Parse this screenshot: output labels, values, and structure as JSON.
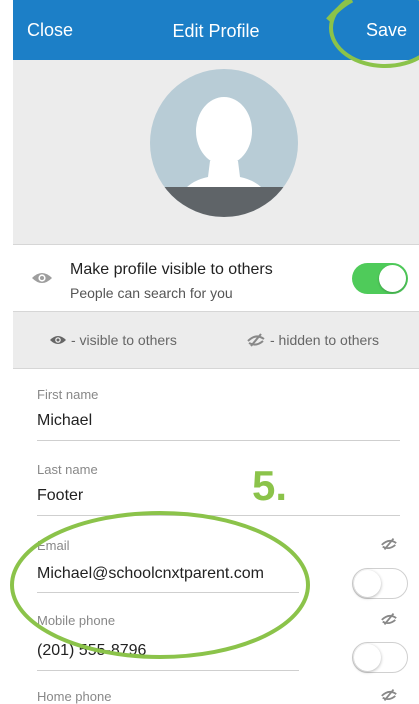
{
  "nav": {
    "close": "Close",
    "title": "Edit Profile",
    "save": "Save"
  },
  "visibility": {
    "title": "Make profile visible to others",
    "subtitle": "People can search for you",
    "enabled": true
  },
  "legend": {
    "visible": "- visible to others",
    "hidden": "- hidden to others"
  },
  "fields": {
    "first_name": {
      "label": "First name",
      "value": "Michael"
    },
    "last_name": {
      "label": "Last name",
      "value": "Footer"
    },
    "email": {
      "label": "Email",
      "value": "Michael@schoolcnxtparent.com",
      "visible": false
    },
    "mobile": {
      "label": "Mobile phone",
      "value": "(201) 555-8796",
      "visible": false
    },
    "home": {
      "label": "Home phone"
    }
  },
  "annotation": {
    "step": "5."
  },
  "colors": {
    "nav": "#1c7fc7",
    "toggle_on": "#4fcb5a",
    "annotation": "#8bc34a"
  },
  "icons": [
    "pencil-icon",
    "eye-icon",
    "eye-slash-icon"
  ]
}
